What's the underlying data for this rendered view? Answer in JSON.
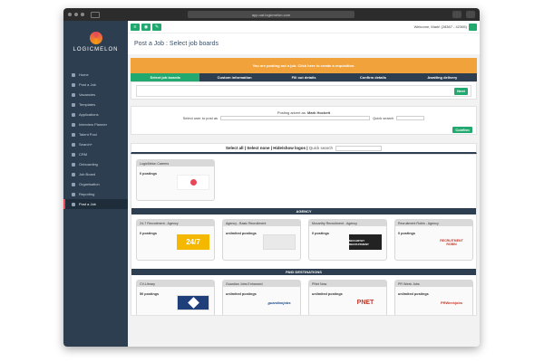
{
  "browser": {
    "url": "app.uat.logicmelon.com"
  },
  "brand": {
    "logo_text": "LOGICMELON"
  },
  "sidebar": {
    "items": [
      {
        "label": "Home",
        "icon": "home-icon"
      },
      {
        "label": "Post a Job",
        "icon": "edit-icon"
      },
      {
        "label": "Vacancies",
        "icon": "briefcase-icon"
      },
      {
        "label": "Templates",
        "icon": "document-icon"
      },
      {
        "label": "Applications",
        "icon": "inbox-icon"
      },
      {
        "label": "Interview Planner",
        "icon": "calendar-icon"
      },
      {
        "label": "Talent Pool",
        "icon": "users-icon"
      },
      {
        "label": "Search+",
        "icon": "search-icon"
      },
      {
        "label": "CRM",
        "icon": "contacts-icon"
      },
      {
        "label": "Onboarding",
        "icon": "clipboard-icon"
      },
      {
        "label": "Job Board",
        "icon": "list-icon"
      },
      {
        "label": "Organisation",
        "icon": "building-icon"
      },
      {
        "label": "Reporting",
        "icon": "chart-icon"
      },
      {
        "label": "Post a Job",
        "icon": "edit-icon",
        "active": true
      }
    ]
  },
  "header": {
    "welcome": "Welcome, Mark! (28367 - 42365)"
  },
  "page": {
    "title": "Post a Job : Select job boards"
  },
  "banner": {
    "line1": "You are posting out a job. Click here to create a requisition."
  },
  "steps": [
    "Select job boards",
    "Custom information",
    "Fill out details",
    "Confirm details",
    "Awaiting delivery"
  ],
  "next_button": "Next",
  "posting": {
    "posting_as_prefix": "Posting advert as:",
    "posting_as_name": "Mark Hockett",
    "select_user_label": "Select user to post as",
    "quick_search_label": "Quick search",
    "confirm_button": "Confirm"
  },
  "filter": {
    "select_all": "Select all",
    "select_none": "Select none",
    "hide_show": "Hide/show logos",
    "quick_search": "Quick search"
  },
  "boards": {
    "own": [
      {
        "name": "LogicMelon Careers",
        "postings": "0 postings"
      }
    ],
    "agency_title": "AGENCY",
    "agency": [
      {
        "name": "24-7 Recruitment - Agency",
        "postings": "0 postings",
        "logo": "24/7"
      },
      {
        "name": "Agency - Basic Recruitment",
        "postings": "unlimited postings",
        "logo": ""
      },
      {
        "name": "Mccarthy Recruitment - Agency",
        "postings": "0 postings",
        "logo": "MCCARTHY RECRUITMENT"
      },
      {
        "name": "Recruitment Robin - Agency",
        "postings": "0 postings",
        "logo": "RECRUITMENT ROBIN"
      }
    ],
    "paid_title": "PAID DESTINATIONS",
    "paid": [
      {
        "name": "CV-Library",
        "postings": "50 postings",
        "logo": ""
      },
      {
        "name": "Guardian Jobs Enhanced",
        "postings": "unlimited postings",
        "logo": "guardianjobs"
      },
      {
        "name": "PNet Now",
        "postings": "unlimited postings",
        "logo": "PNET"
      },
      {
        "name": "PR Week Jobs",
        "postings": "unlimited postings",
        "logo": "PRWeekjobs"
      }
    ]
  }
}
